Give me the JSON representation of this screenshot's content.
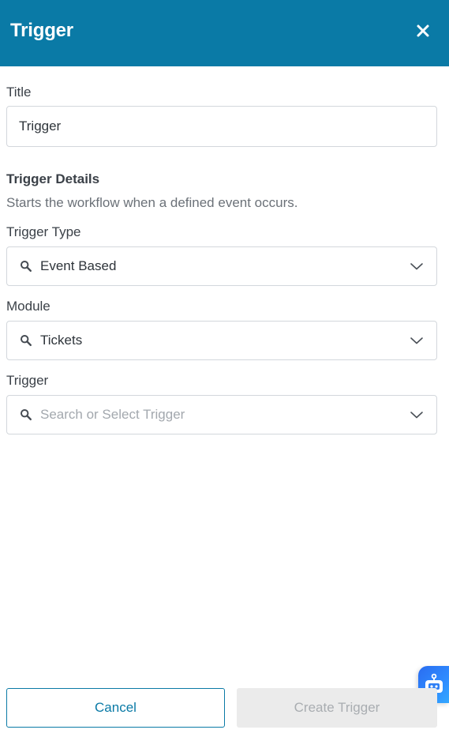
{
  "header": {
    "title": "Trigger"
  },
  "title_field": {
    "label": "Title",
    "value": "Trigger"
  },
  "trigger_details": {
    "heading": "Trigger Details",
    "description": "Starts the workflow when a defined event occurs."
  },
  "trigger_type": {
    "label": "Trigger Type",
    "value": "Event Based"
  },
  "module": {
    "label": "Module",
    "value": "Tickets"
  },
  "trigger": {
    "label": "Trigger",
    "placeholder": "Search or Select Trigger"
  },
  "footer": {
    "cancel_label": "Cancel",
    "create_label": "Create Trigger"
  },
  "colors": {
    "header_bg": "#0a7aa6",
    "accent": "#0a7aa6",
    "disabled_bg": "#ebebeb"
  },
  "icons": [
    "close-icon",
    "search-icon",
    "chevron-down-icon",
    "bot-icon"
  ]
}
